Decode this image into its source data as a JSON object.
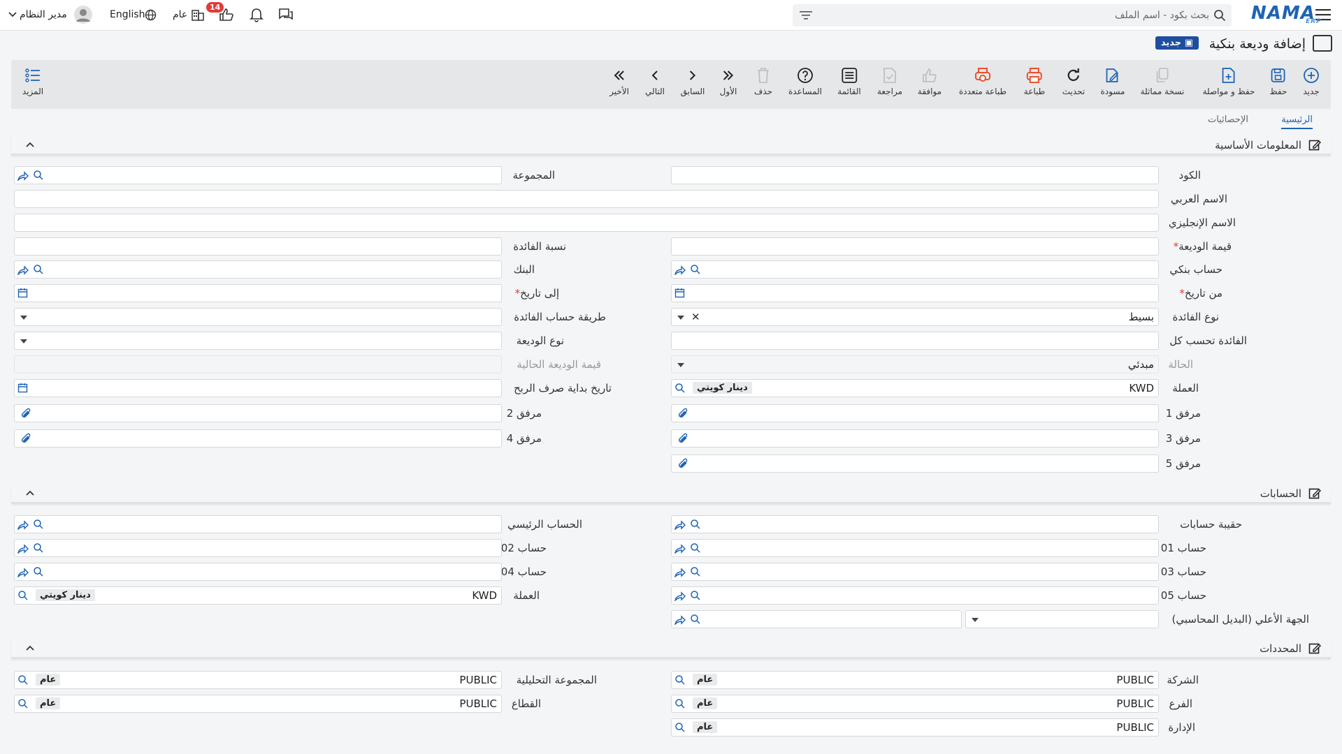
{
  "app": {
    "brand": "NAMA",
    "brand_sub": "ERP",
    "accent": "#1e63b5"
  },
  "topbar": {
    "search_placeholder": "بحث بكود - اسم الملف",
    "language": "English",
    "scope": "عام",
    "notification_count": "14",
    "user": "مدير النظام"
  },
  "page": {
    "title": "إضافة وديعة بنكية",
    "new_badge": "جديد"
  },
  "toolbar": {
    "new": "جديد",
    "save": "حفظ",
    "save_continue": "حفظ و مواصلة",
    "duplicate": "نسخة مماثلة",
    "draft": "مسودة",
    "refresh": "تحديث",
    "print": "طباعة",
    "multi_print": "طباعة متعددة",
    "approve": "موافقة",
    "review": "مراجعة",
    "list": "القائمة",
    "help": "المساعدة",
    "delete": "حذف",
    "first": "الأول",
    "previous": "السابق",
    "next": "التالي",
    "last": "الأخير",
    "more": "المزيد"
  },
  "tabs": {
    "main": "الرئيسية",
    "stats": "الإحصائيات"
  },
  "sections": {
    "basic": "المعلومات الأساسية",
    "accounts": "الحسابات",
    "dimensions": "المحددات"
  },
  "basic": {
    "code": "الكود",
    "group": "المجموعة",
    "arabic_name": "الاسم العربي",
    "english_name": "الاسم الإنجليزي",
    "deposit_value": "قيمة الوديعة",
    "interest_rate": "نسبة الفائدة",
    "bank_account": "حساب بنكي",
    "bank": "البنك",
    "from_date": "من تاريخ",
    "to_date": "إلى تاريخ",
    "interest_type": "نوع الفائدة",
    "interest_type_value": "بسيط",
    "interest_calc_method": "طريقة حساب الفائدة",
    "interest_every": "الفائدة تحسب كل",
    "deposit_type": "نوع الوديعة",
    "status": "الحالة",
    "status_value": "مبدئي",
    "current_value": "قيمة الوديعة الحالية",
    "currency": "العملة",
    "currency_code": "KWD",
    "currency_name": "دينار كويتي",
    "profit_start_date": "تاريخ بداية صرف الربح",
    "attach1": "مرفق 1",
    "attach2": "مرفق 2",
    "attach3": "مرفق 3",
    "attach4": "مرفق 4",
    "attach5": "مرفق 5"
  },
  "accounts": {
    "bag": "حقيبة حسابات",
    "main_account": "الحساب الرئيسي",
    "acc01": "حساب 01",
    "acc02": "حساب 02",
    "acc03": "حساب 03",
    "acc04": "حساب 04",
    "acc05": "حساب 05",
    "currency": "العملة",
    "currency_code": "KWD",
    "currency_name": "دينار كويتي",
    "higher_party": "الجهة الأعلي (البديل المحاسبي)"
  },
  "dimensions": {
    "company": "الشركة",
    "analytic_group": "المجموعة التحليلية",
    "branch": "الفرع",
    "sector": "القطاع",
    "department": "الإدارة",
    "public_code": "PUBLIC",
    "public_name": "عام"
  }
}
